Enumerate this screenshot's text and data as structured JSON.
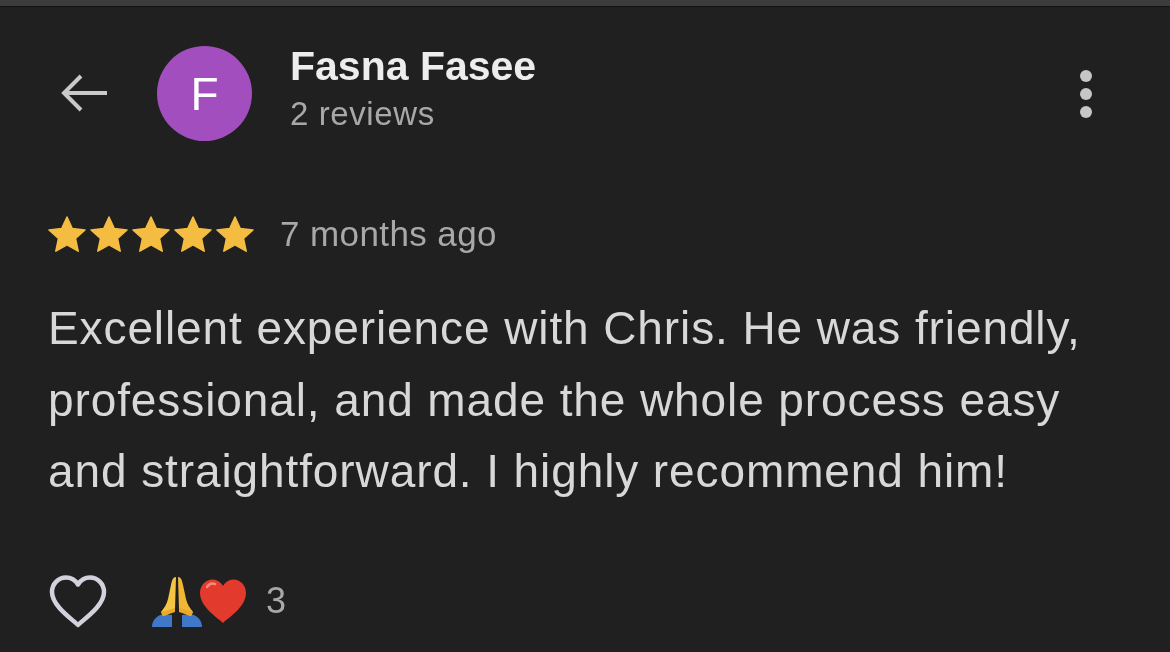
{
  "reviewer": {
    "initial": "F",
    "name": "Fasna Fasee",
    "review_count": "2 reviews"
  },
  "review": {
    "stars": 5,
    "time": "7 months ago",
    "text": "Excellent experience with Chris. He was friendly, professional, and made the whole process easy and straightforward. I highly recommend him!"
  },
  "reactions": {
    "liked": false,
    "count": "3"
  }
}
